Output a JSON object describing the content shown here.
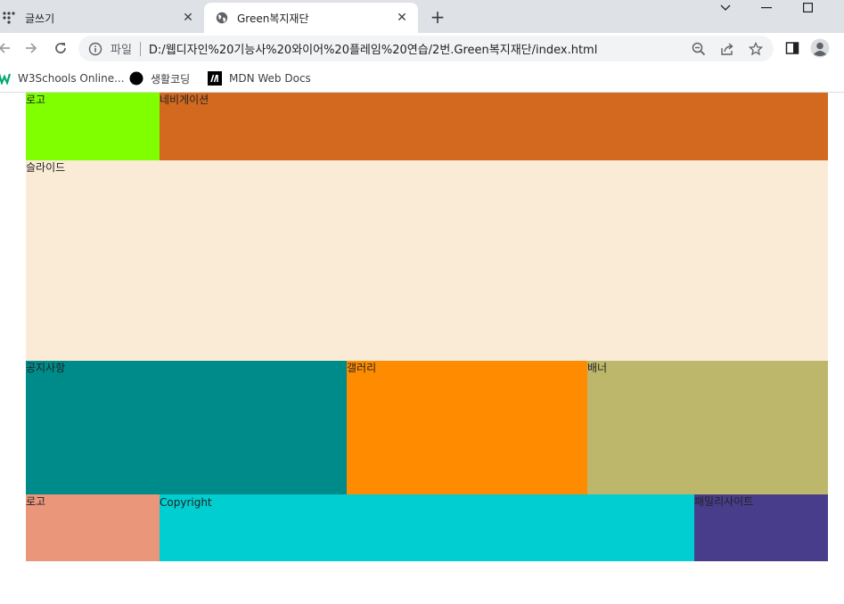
{
  "browser": {
    "tabs": [
      {
        "title": "글쓰기",
        "favicon": "dots-app-icon"
      },
      {
        "title": "Green복지재단",
        "favicon": "globe-icon"
      }
    ],
    "address": {
      "scheme_label": "파일",
      "url": "D:/웹디자인%20기능사%20와이어%20플레임%20연습/2번.Green복지재단/index.html"
    },
    "bookmarks": [
      {
        "label": "W3Schools Online...",
        "icon": "w3schools-icon"
      },
      {
        "label": "생활코딩",
        "icon": "black-circle-icon"
      },
      {
        "label": "MDN Web Docs",
        "icon": "mdn-icon"
      }
    ]
  },
  "page": {
    "header": {
      "logo": "로고",
      "nav": "네비게이션"
    },
    "slide": "슬라이드",
    "contents": {
      "notice": "공지사항",
      "gallery": "갤러리",
      "banner": "배너"
    },
    "footer": {
      "logo": "로고",
      "copyright": "Copyright",
      "family_site": "패밀리사이트"
    },
    "colors": {
      "logo": "#7fff00",
      "nav": "#d2691e",
      "slide": "#faebd7",
      "notice": "#008b8b",
      "gallery": "#ff8c00",
      "banner": "#bdb76b",
      "footer_logo": "#e9967a",
      "copyright": "#00ced1",
      "family_site": "#483d8b"
    }
  }
}
